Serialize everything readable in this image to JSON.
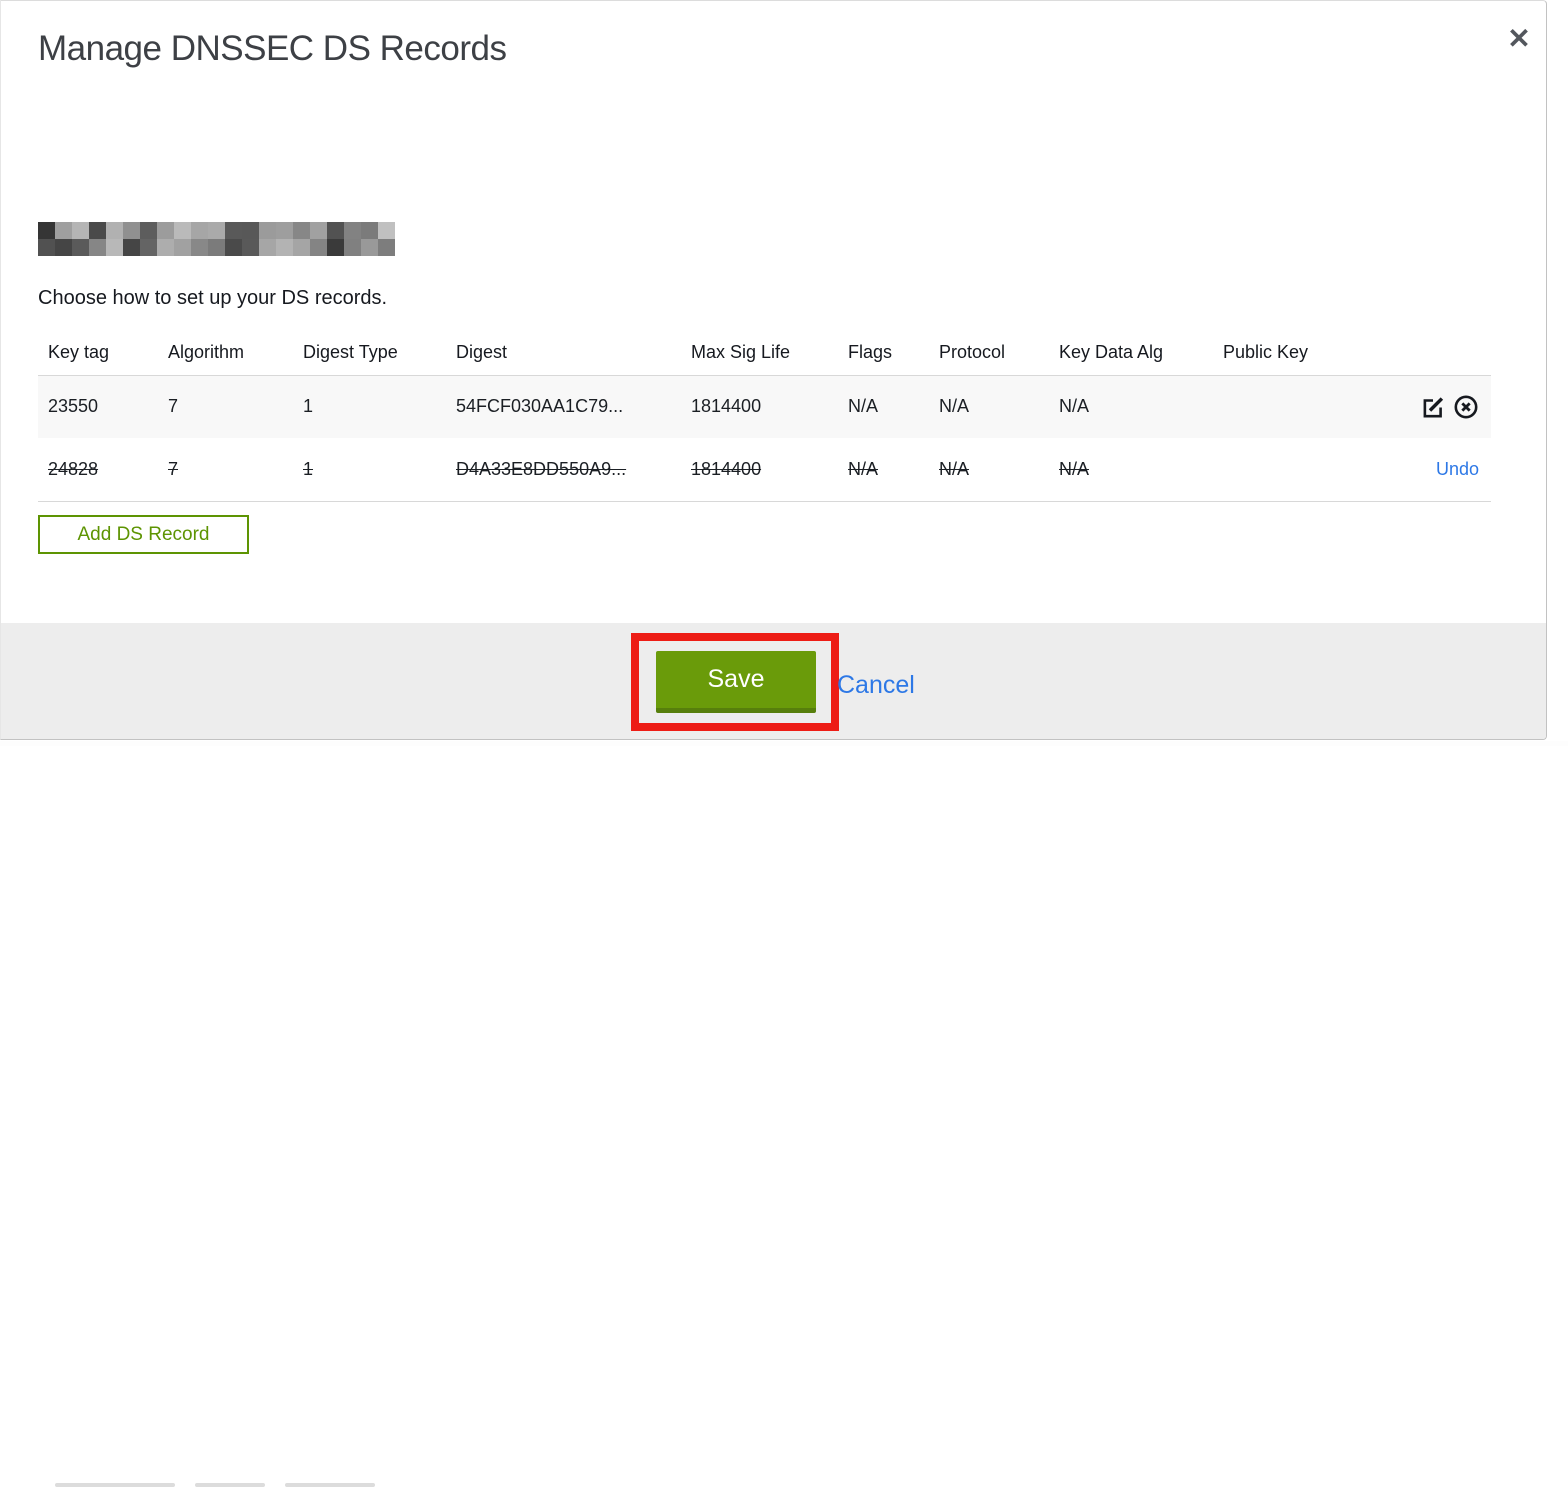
{
  "dialog": {
    "title": "Manage DNSSEC DS Records",
    "close_icon": "✕",
    "domain_redacted": true,
    "instruction": "Choose how to set up your DS records."
  },
  "table": {
    "columns": [
      "Key tag",
      "Algorithm",
      "Digest Type",
      "Digest",
      "Max Sig Life",
      "Flags",
      "Protocol",
      "Key Data Alg",
      "Public Key"
    ],
    "rows": [
      {
        "state": "active",
        "cells": [
          "23550",
          "7",
          "1",
          "54FCF030AA1C79...",
          "1814400",
          "N/A",
          "N/A",
          "N/A",
          ""
        ],
        "actions": [
          "edit",
          "delete"
        ]
      },
      {
        "state": "deleted",
        "cells": [
          "24828",
          "7",
          "1",
          "D4A33E8DD550A9...",
          "1814400",
          "N/A",
          "N/A",
          "N/A",
          ""
        ],
        "undo_label": "Undo"
      }
    ]
  },
  "buttons": {
    "add_record": "Add DS Record",
    "save": "Save",
    "cancel": "Cancel"
  },
  "colors": {
    "accent_green": "#6A9B0A",
    "outline_green": "#5D9402",
    "link_blue": "#2D78E6",
    "annotation_red": "#ED1C15",
    "footer_bg": "#EDEDED",
    "row_alt_bg": "#F8F8F8"
  }
}
